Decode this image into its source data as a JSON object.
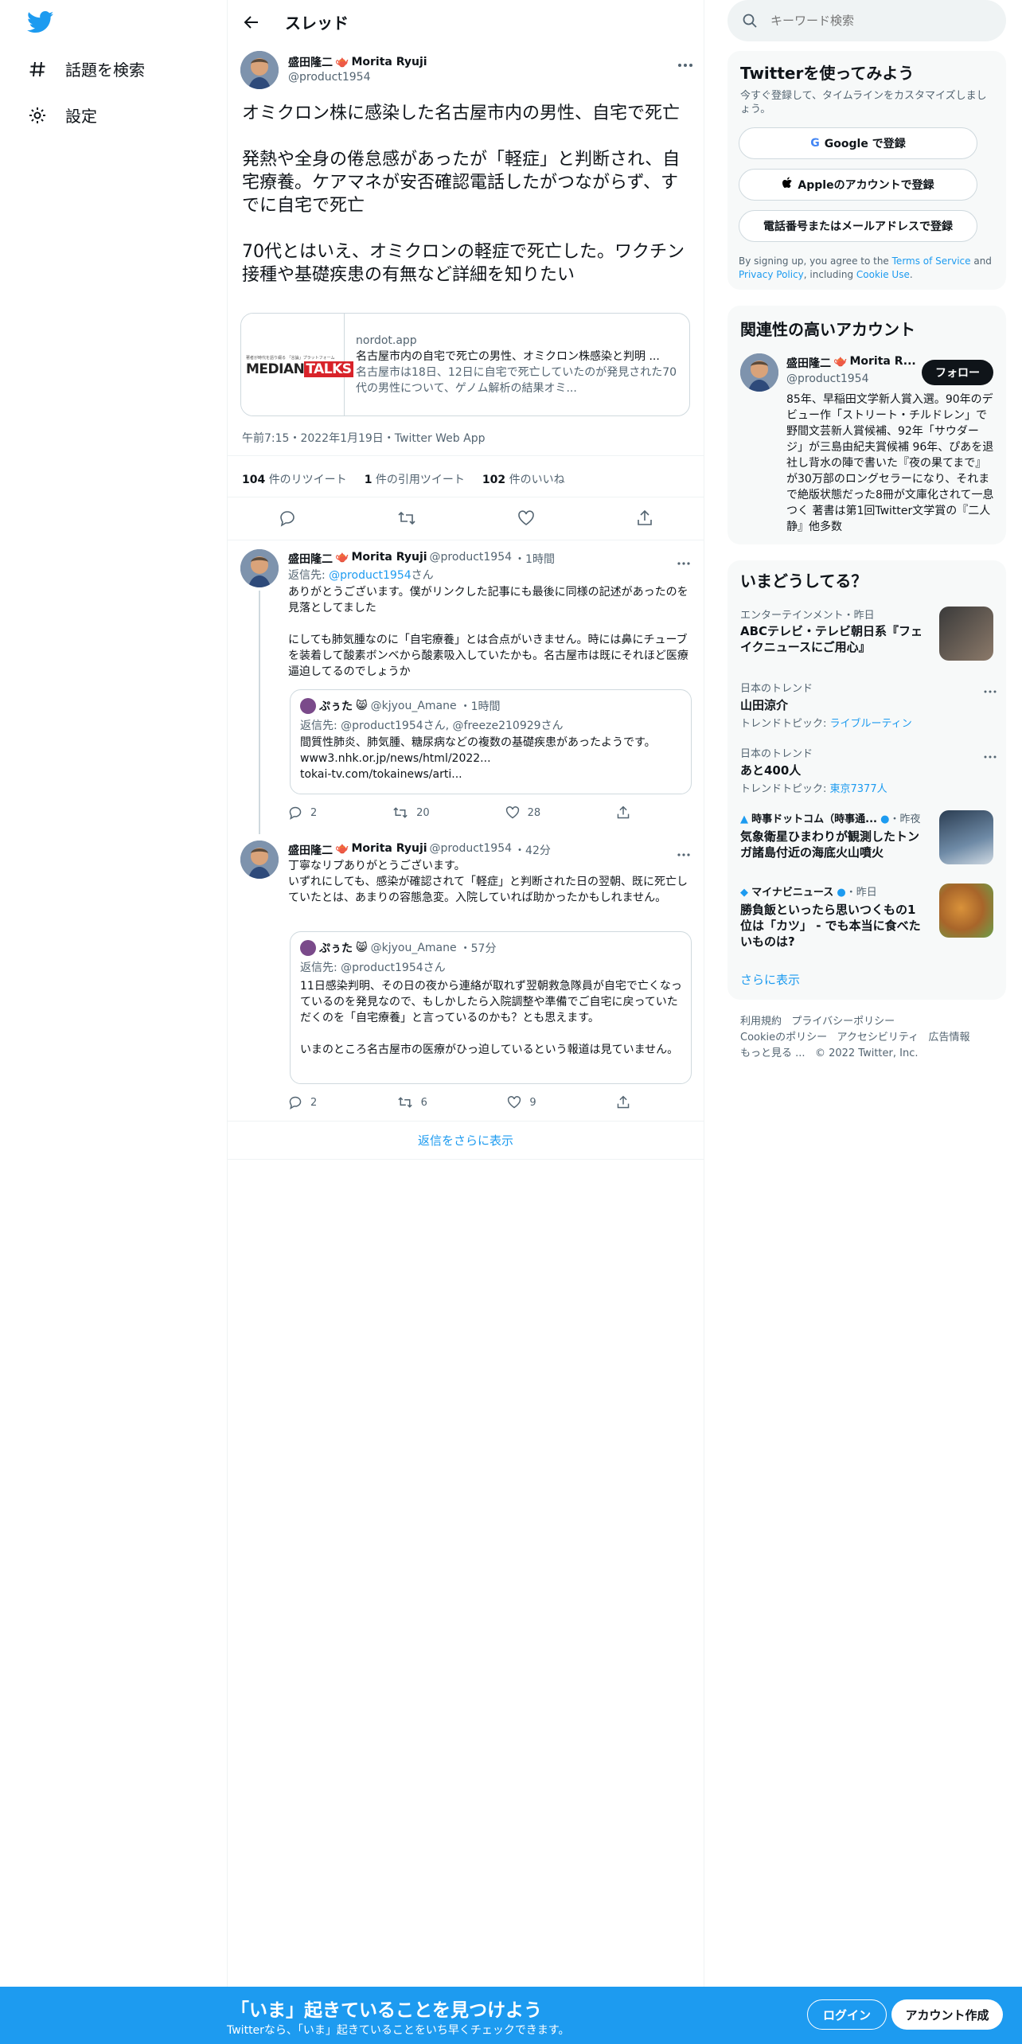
{
  "nav": {
    "explore": "話題を検索",
    "settings": "設定"
  },
  "header": {
    "title": "スレッド"
  },
  "tweet": {
    "author_name": "盛田隆二",
    "author_name_en": "Morita Ryuji",
    "handle": "@product1954",
    "text": "オミクロン株に感染した名古屋市内の男性、自宅で死亡\n\n発熱や全身の倦怠感があったが「軽症」と判断され、自宅療養。ケアマネが安否確認電話したがつながらず、すでに自宅で死亡\n\n70代とはいえ、オミクロンの軽症で死亡した。ワクチン接種や基礎疾患の有無など詳細を知りたい",
    "card": {
      "domain": "nordot.app",
      "title": "名古屋市内の自宅で死亡の男性、オミクロン株感染と判明 ...",
      "desc": "名古屋市は18日、12日に自宅で死亡していたのが発見された70代の男性について、ゲノム解析の結果オミ...",
      "logo_caption": "著者が時代を語り綴る 「言論」プラットフォーム",
      "logo_a": "MEDIAN",
      "logo_b": "TALKS"
    },
    "timestamp": "午前7:15・2022年1月19日・Twitter Web App",
    "retweets": "104",
    "retweets_label": "件のリツイート",
    "quotes": "1",
    "quotes_label": "件の引用ツイート",
    "likes": "102",
    "likes_label": "件のいいね"
  },
  "replies": [
    {
      "author_name": "盛田隆二",
      "author_name_en": "Morita Ryuji",
      "handle": "@product1954",
      "time": "・1時間",
      "reply_to_label": "返信先:",
      "reply_to": "@product1954",
      "reply_to_suffix": "さん",
      "text": "ありがとうございます。僕がリンクした記事にも最後に同様の記述があったのを見落としてました\n\nにしても肺気腫なのに「自宅療養」とは合点がいきません。時には鼻にチューブを装着して酸素ボンベから酸素吸入していたかも。名古屋市は既にそれほど医療逼迫してるのでしょうか",
      "quote": {
        "name": "ぷぅた",
        "handle": "@kjyou_Amane",
        "time": "・1時間",
        "reply_to": "返信先: @product1954さん, @freeze210929さん",
        "text": "間質性肺炎、肺気腫、糖尿病などの複数の基礎疾患があったようです。www3.nhk.or.jp/news/html/2022...\ntokai-tv.com/tokainews/arti..."
      },
      "reply_count": "2",
      "retweet_count": "20",
      "like_count": "28"
    },
    {
      "author_name": "盛田隆二",
      "author_name_en": "Morita Ryuji",
      "handle": "@product1954",
      "time": "・42分",
      "text": "丁寧なリプありがとうございます。\nいずれにしても、感染が確認されて「軽症」と判断された日の翌朝、既に死亡していたとは、あまりの容態急変。入院していれば助かったかもしれません。",
      "quote": {
        "name": "ぷぅた",
        "handle": "@kjyou_Amane",
        "time": "・57分",
        "reply_to": "返信先: @product1954さん",
        "text": "11日感染判明、その日の夜から連絡が取れず翌朝救急隊員が自宅で亡くなっているのを発見なので、もしかしたら入院調整や準備でご自宅に戻っていただくのを「自宅療養」と言っているのかも？とも思えます。\n\nいまのところ名古屋市の医療がひっ迫しているという報道は見ていません。"
      },
      "reply_count": "2",
      "retweet_count": "6",
      "like_count": "9"
    }
  ],
  "show_more_replies": "返信をさらに表示",
  "right": {
    "search_placeholder": "キーワード検索",
    "signup": {
      "title": "Twitterを使ってみよう",
      "subtitle": "今すぐ登録して、タイムラインをカスタマイズしましょう。",
      "google": "Google で登録",
      "apple": "Appleのアカウントで登録",
      "phone": "電話番号またはメールアドレスで登録",
      "terms_a": "By signing up, you agree to the ",
      "terms_link1": "Terms of Service",
      "terms_b": " and ",
      "terms_link2": "Privacy Policy",
      "terms_c": ", including ",
      "terms_link3": "Cookie Use",
      "terms_d": "."
    },
    "related": {
      "title": "関連性の高いアカウント",
      "name": "盛田隆二",
      "name_en": "Morita R...",
      "handle": "@product1954",
      "follow": "フォロー",
      "bio": "85年、早稲田文学新人賞入選。90年のデビュー作「ストリート・チルドレン」で野間文芸新人賞候補、92年「サウダージ」が三島由紀夫賞候補 96年、ぴあを退社し背水の陣で書いた『夜の果てまで』が30万部のロングセラーになり、それまで絶版状態だった8冊が文庫化されて一息つく 著書は第1回Twitter文学賞の『二人静』他多数"
    },
    "trends": {
      "title": "いまどうしてる？",
      "items": [
        {
          "meta": "エンターテインメント・昨日",
          "title": "ABCテレビ・テレビ朝日系『フェイクニュースにご用心』"
        },
        {
          "meta": "日本のトレンド",
          "title": "山田涼介",
          "topic_label": "トレンドトピック: ",
          "topic": "ライブルーティン"
        },
        {
          "meta": "日本のトレンド",
          "title": "あと400人",
          "topic_label": "トレンドトピック: ",
          "topic": "東京7377人"
        },
        {
          "source": "時事ドットコム（時事通...",
          "meta": "・昨夜",
          "title": "気象衛星ひまわりが観測したトンガ諸島付近の海底火山噴火"
        },
        {
          "source": "マイナビニュース",
          "meta": "・昨日",
          "title": "勝負飯といったら思いつくもの1位は「カツ」 - でも本当に食べたいものは?"
        }
      ],
      "show_more": "さらに表示"
    },
    "footer": [
      "利用規約",
      "プライバシーポリシー",
      "Cookieのポリシー",
      "アクセシビリティ",
      "広告情報",
      "もっと見る ...",
      "© 2022 Twitter, Inc."
    ]
  },
  "bottom": {
    "title": "「いま」起きていることを見つけよう",
    "subtitle": "Twitterなら、「いま」起きていることをいち早くチェックできます。",
    "login": "ログイン",
    "signup": "アカウント作成"
  },
  "colors": {
    "brand": "#1d9bf0",
    "text": "#0f1419",
    "muted": "#536471",
    "border": "#cfd9de"
  }
}
